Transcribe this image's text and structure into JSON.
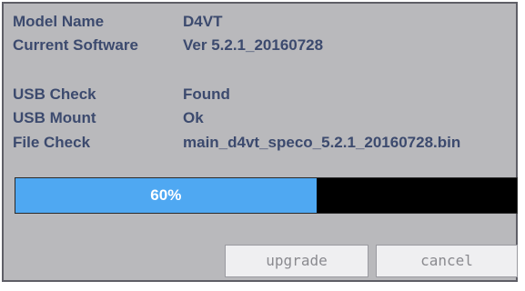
{
  "info": {
    "model_name_label": "Model Name",
    "model_name_value": "D4VT",
    "current_software_label": "Current Software",
    "current_software_value": "Ver 5.2.1_20160728",
    "usb_check_label": "USB Check",
    "usb_check_value": "Found",
    "usb_mount_label": "USB Mount",
    "usb_mount_value": "Ok",
    "file_check_label": "File Check",
    "file_check_value": "main_d4vt_speco_5.2.1_20160728.bin"
  },
  "progress": {
    "value": 60,
    "label": "60%",
    "fill_color": "#4fa8f2",
    "track_color": "#000000"
  },
  "buttons": {
    "upgrade_label": "upgrade",
    "cancel_label": "cancel"
  }
}
